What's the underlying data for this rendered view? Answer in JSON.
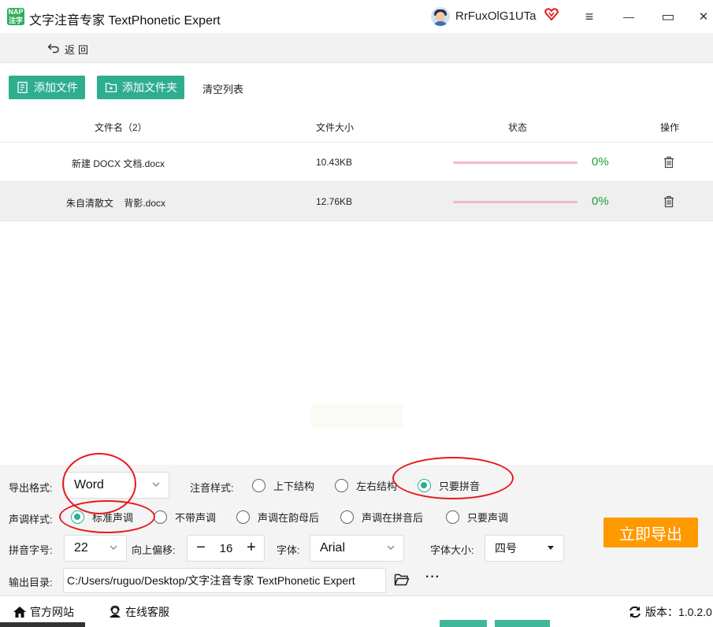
{
  "window": {
    "title": "文字注音专家 TextPhonetic Expert",
    "logo_text_top": "NAP",
    "logo_text_bottom": "注字",
    "username": "RrFuxOlG1UTa",
    "controls": {
      "menu": "≡",
      "minimize": "—",
      "maximize": "▭",
      "close": "✕"
    }
  },
  "nav": {
    "back_label": "返回"
  },
  "toolbar": {
    "add_file": "添加文件",
    "add_folder": "添加文件夹",
    "clear_list": "清空列表"
  },
  "table": {
    "headers": {
      "filename": "文件名（2）",
      "size": "文件大小",
      "status": "状态",
      "action": "操作"
    },
    "rows": [
      {
        "name": "新建 DOCX 文档.docx",
        "size": "10.43KB",
        "progress": "0%"
      },
      {
        "name": "朱自清散文    背影.docx",
        "size": "12.76KB",
        "progress": "0%"
      }
    ]
  },
  "settings": {
    "export_format_label": "导出格式:",
    "export_format_value": "Word",
    "phonetic_style_label": "注音样式:",
    "phonetic_options": [
      {
        "label": "上下结构",
        "checked": false
      },
      {
        "label": "左右结构",
        "checked": false
      },
      {
        "label": "只要拼音",
        "checked": true
      }
    ],
    "tone_style_label": "声调样式:",
    "tone_options": [
      {
        "label": "标准声调",
        "checked": true
      },
      {
        "label": "不带声调",
        "checked": false
      },
      {
        "label": "声调在韵母后",
        "checked": false
      },
      {
        "label": "声调在拼音后",
        "checked": false
      },
      {
        "label": "只要声调",
        "checked": false
      }
    ],
    "pinyin_size_label": "拼音字号:",
    "pinyin_size_value": "22",
    "offset_label": "向上偏移:",
    "offset_minus": "−",
    "offset_value": "16",
    "offset_plus": "+",
    "font_label": "字体:",
    "font_value": "Arial",
    "font_size_label": "字体大小:",
    "font_size_value": "四号",
    "output_dir_label": "输出目录:",
    "output_dir_value": "C:/Users/ruguo/Desktop/文字注音专家 TextPhonetic Expert",
    "more_label": "···",
    "export_button": "立即导出"
  },
  "footer": {
    "website": "官方网站",
    "support": "在线客服",
    "version": "版本：1.0.2.0"
  },
  "colors": {
    "accent_green": "#2eae8f",
    "export_orange": "#ff9900",
    "progress_pink": "#f2b8c6",
    "percent_green": "#1f9e3a",
    "annotation_red": "#e8191f"
  }
}
